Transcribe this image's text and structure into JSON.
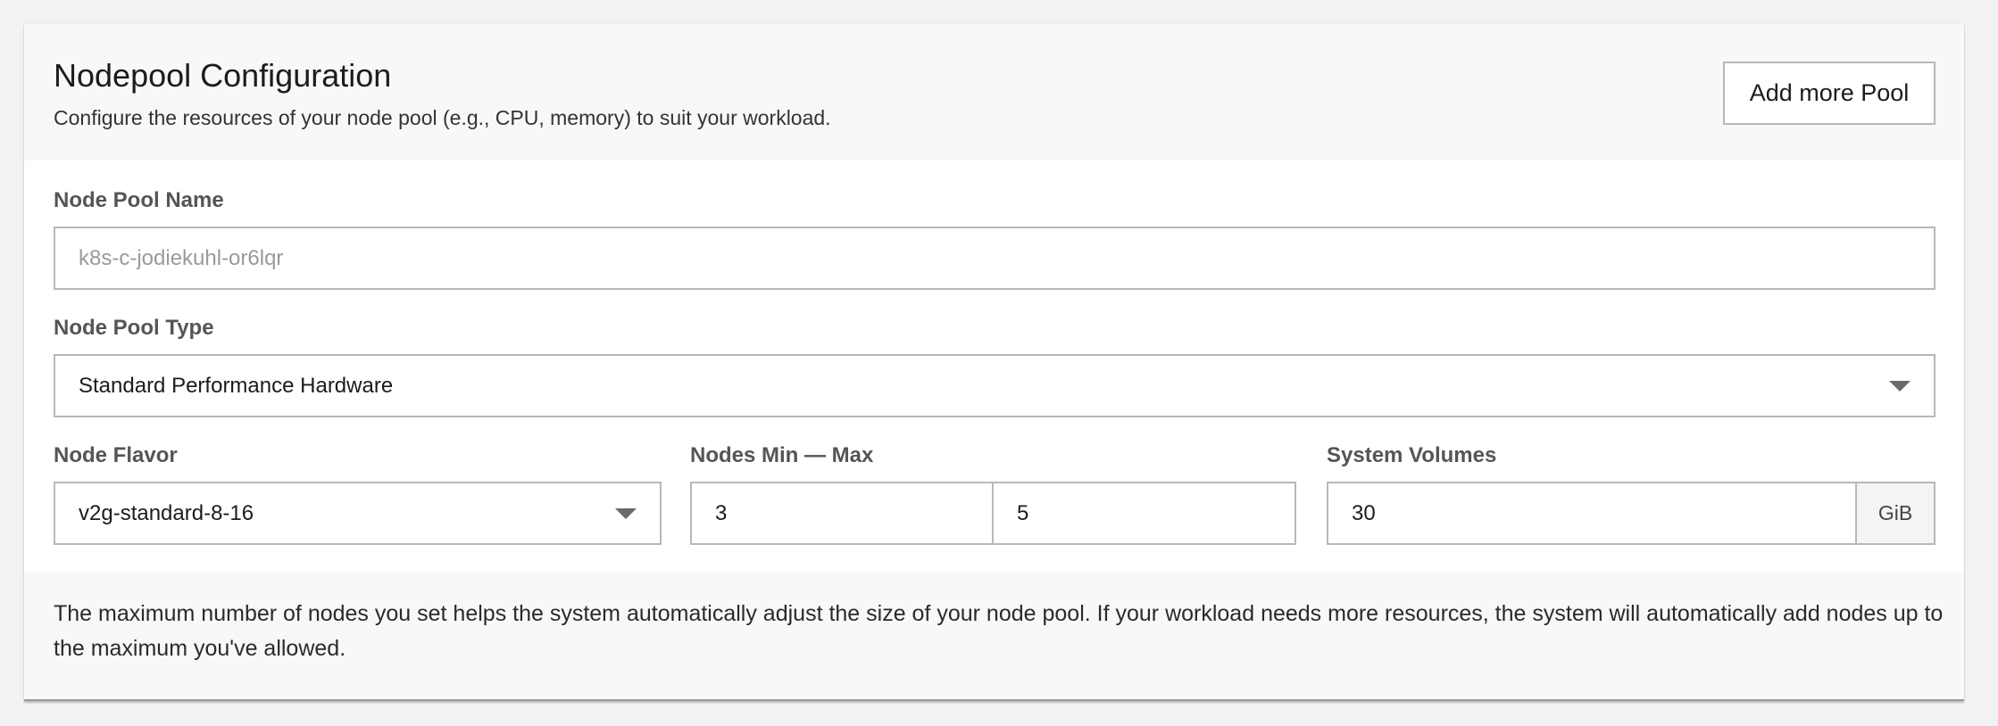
{
  "header": {
    "title": "Nodepool Configuration",
    "subtitle": "Configure the resources of your node pool (e.g., CPU, memory) to suit your workload.",
    "add_pool_label": "Add more Pool"
  },
  "node_pool_name": {
    "label": "Node Pool Name",
    "placeholder": "k8s-c-jodiekuhl-or6lqr",
    "value": ""
  },
  "node_pool_type": {
    "label": "Node Pool Type",
    "selected": "Standard Performance Hardware",
    "icon": "chevron-down-icon"
  },
  "node_flavor": {
    "label": "Node Flavor",
    "selected": "v2g-standard-8-16",
    "icon": "chevron-down-icon"
  },
  "nodes_range": {
    "label": "Nodes Min — Max",
    "min": "3",
    "max": "5"
  },
  "system_volumes": {
    "label": "System Volumes",
    "value": "30",
    "unit": "GiB"
  },
  "footer": {
    "help_text": "The maximum number of nodes you set helps the system automatically adjust the size of your node pool. If your workload needs more resources, the system will automatically add nodes up to the maximum you've allowed."
  },
  "colors": {
    "page_background": "#f1f2f1",
    "card_background": "#ffffff",
    "section_background": "#f8f8f8",
    "border": "#b8b8b8",
    "label_text": "#555555"
  }
}
